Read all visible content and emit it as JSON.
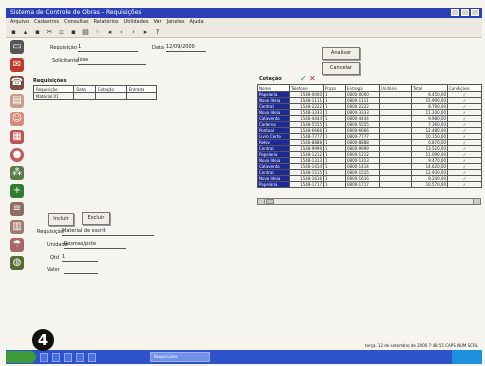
{
  "window": {
    "title": "Sistema de Controle de Obras - Requisições"
  },
  "menu": [
    "Arquivo",
    "Cadastros",
    "Consultas",
    "Relatórios",
    "Utilidades",
    "Ver",
    "Janelas",
    "Ajuda"
  ],
  "toolbar_icons": [
    "new-icon",
    "open-icon",
    "save-icon",
    "cut-icon",
    "copy-icon",
    "paste-icon",
    "print-icon",
    "find-icon",
    "first-icon",
    "prev-icon",
    "next-icon",
    "last-icon",
    "help-icon"
  ],
  "sidebar_icons": [
    "folder-icon",
    "mail-icon",
    "phone-icon",
    "document-icon",
    "user-icon",
    "calendar-icon",
    "chart-icon",
    "network-icon",
    "plus-icon",
    "stack-icon",
    "book-icon",
    "umbrella-icon",
    "globe-icon"
  ],
  "form": {
    "requisicao_label": "Requisição",
    "requisicao_value": "1",
    "data_label": "Data",
    "data_value": "12/09/2000",
    "solicitante_label": "Solicitante",
    "solicitante_value": "Jose"
  },
  "buttons": {
    "analisar": "Analisar",
    "cancelar": "Cancelar",
    "incluir": "Incluir",
    "excluir": "Excluir"
  },
  "requisicoes": {
    "title": "Requisições",
    "columns": [
      "Requisição",
      "Data",
      "Cotação",
      "Entrada"
    ],
    "rows": [
      [
        "Material 01",
        "",
        "",
        ""
      ]
    ]
  },
  "cotacao": {
    "title": "Cotação"
  },
  "detail": {
    "requisicao_label": "Requisição",
    "requisicao_value": "Material de escrit",
    "unidade_label": "Unidade",
    "unidade_value": "Resmas/pcte",
    "qtd_label": "Qtd",
    "qtd_value": "1",
    "valor_label": "Valor"
  },
  "quotes": {
    "columns": [
      "Nome",
      "Telefone",
      "Prazo",
      "Entrega",
      "Unitário",
      "Total",
      "Condições"
    ],
    "rows": [
      [
        "Papelaria",
        "1548-0000",
        "1",
        "0800-0000",
        "",
        "6.450,00",
        "✓"
      ],
      [
        "Novo Ideia",
        "1548-1111",
        "1",
        "0800-1111",
        "",
        "15.990,00",
        "✓"
      ],
      [
        "Central",
        "1548-2222",
        "1",
        "0800-2222",
        "",
        "8.790,00",
        "✓"
      ],
      [
        "Nova Ideia",
        "1548-3333",
        "1",
        "0800-3333",
        "",
        "11.240,00",
        "✓"
      ],
      [
        "Catavento",
        "1548-4444",
        "1",
        "0800-4444",
        "",
        "9.980,00",
        "✓"
      ],
      [
        "Caderno",
        "1548-5555",
        "1",
        "0800-5555",
        "",
        "7.360,00",
        "✓"
      ],
      [
        "Pontual",
        "1548-6666",
        "1",
        "0800-6666",
        "",
        "12.480,00",
        "✓"
      ],
      [
        "Livro Certo",
        "1548-7777",
        "1",
        "0800-7777",
        "",
        "10.150,00",
        "✓"
      ],
      [
        "Relev",
        "1548-8888",
        "1",
        "0800-8888",
        "",
        "6.870,00",
        "✓"
      ],
      [
        "Central",
        "1548-9999",
        "1",
        "0800-9999",
        "",
        "13.520,00",
        "✓"
      ],
      [
        "Papelaria",
        "1548-1212",
        "1",
        "0800-1212",
        "",
        "11.090,00",
        "✓"
      ],
      [
        "Nova Ideia",
        "1548-1313",
        "1",
        "0800-1313",
        "",
        "9.470,00",
        "✓"
      ],
      [
        "Catavento",
        "1548-1414",
        "1",
        "0800-1414",
        "",
        "14.620,00",
        "✓"
      ],
      [
        "Central",
        "1548-1515",
        "1",
        "0800-1515",
        "",
        "12.930,00",
        "✓"
      ],
      [
        "Nova Ideia",
        "1548-1616",
        "1",
        "0800-1616",
        "",
        "8.240,00",
        "✓"
      ],
      [
        "Papelaria",
        "1548-1717",
        "1",
        "0800-1717",
        "",
        "10.570,00",
        "✓"
      ]
    ]
  },
  "statusbar": "terça, 12 de setembro de 2000   7:48:55   CAPS  NUM  SCRL",
  "taskbar": {
    "task_label": "Requisições"
  },
  "badge": "4"
}
